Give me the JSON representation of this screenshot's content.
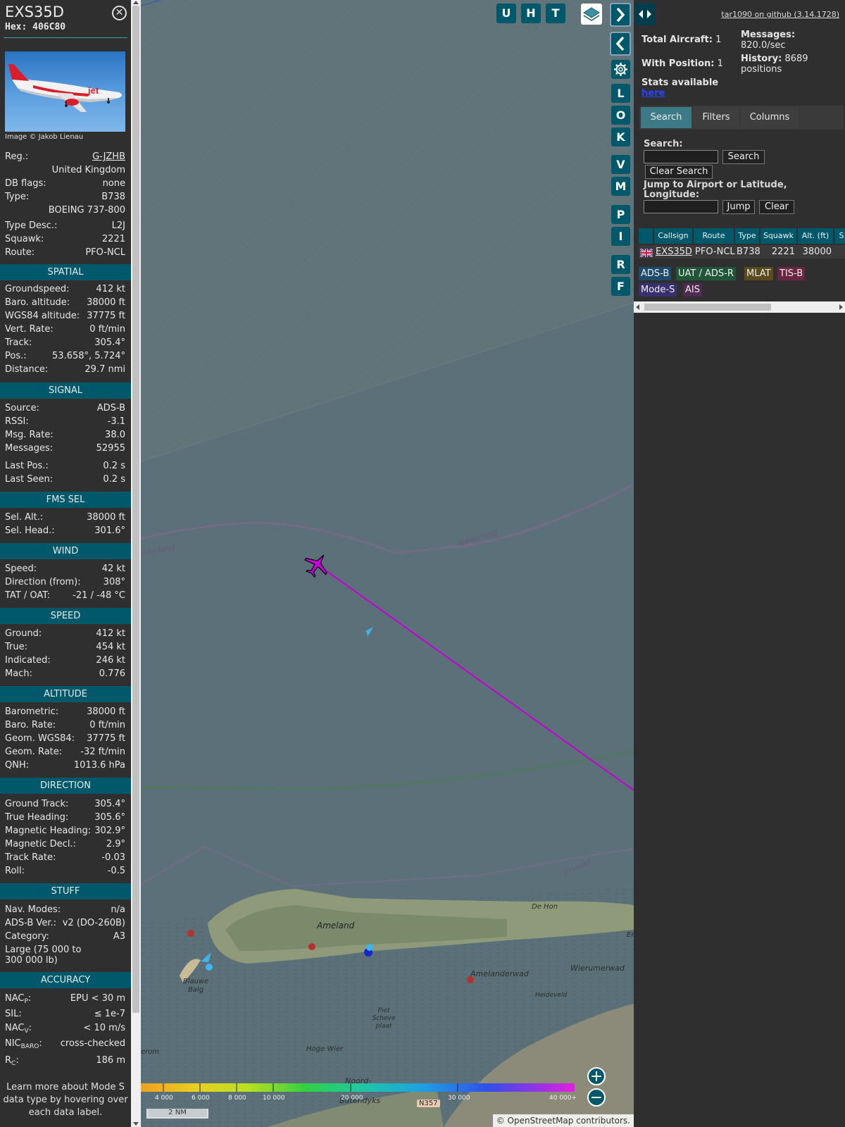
{
  "aircraft": {
    "callsign": "EXS35D",
    "hex_label": "Hex:",
    "hex": "406C80",
    "image_credit": "Image © Jakob Lienau"
  },
  "details": [
    {
      "k": "Reg.:",
      "v": "G-JZHB",
      "link": true
    },
    {
      "k": "",
      "v": "United Kingdom"
    },
    {
      "k": "DB flags:",
      "v": "none"
    },
    {
      "k": "Type:",
      "v": "B738"
    },
    {
      "k": "",
      "v": "BOEING 737-800"
    },
    {
      "k": "Type Desc.:",
      "v": "L2J"
    },
    {
      "k": "Squawk:",
      "v": "2221"
    },
    {
      "k": "Route:",
      "v": "PFO-NCL"
    }
  ],
  "sections": {
    "spatial": {
      "title": "SPATIAL",
      "rows": [
        {
          "k": "Groundspeed:",
          "v": "412 kt"
        },
        {
          "k": "Baro. altitude:",
          "v": "38000 ft"
        },
        {
          "k": "WGS84 altitude:",
          "v": "37775 ft"
        },
        {
          "k": "Vert. Rate:",
          "v": "0 ft/min"
        },
        {
          "k": "Track:",
          "v": "305.4°"
        },
        {
          "k": "Pos.:",
          "v": "53.658°, 5.724°"
        },
        {
          "k": "Distance:",
          "v": "29.7 nmi"
        }
      ]
    },
    "signal": {
      "title": "SIGNAL",
      "rows": [
        {
          "k": "Source:",
          "v": "ADS-B"
        },
        {
          "k": "RSSI:",
          "v": "-3.1"
        },
        {
          "k": "Msg. Rate:",
          "v": "38.0"
        },
        {
          "k": "Messages:",
          "v": "52955"
        },
        {
          "k": "Last Pos.:",
          "v": "0.2 s"
        },
        {
          "k": "Last Seen:",
          "v": "0.2 s"
        }
      ]
    },
    "fms": {
      "title": "FMS SEL",
      "rows": [
        {
          "k": "Sel. Alt.:",
          "v": "38000 ft"
        },
        {
          "k": "Sel. Head.:",
          "v": "301.6°"
        }
      ]
    },
    "wind": {
      "title": "WIND",
      "rows": [
        {
          "k": "Speed:",
          "v": "42 kt"
        },
        {
          "k": "Direction (from):",
          "v": "308°"
        },
        {
          "k": "TAT / OAT:",
          "v": "-21 / -48 °C"
        }
      ]
    },
    "speed": {
      "title": "SPEED",
      "rows": [
        {
          "k": "Ground:",
          "v": "412 kt"
        },
        {
          "k": "True:",
          "v": "454 kt"
        },
        {
          "k": "Indicated:",
          "v": "246 kt"
        },
        {
          "k": "Mach:",
          "v": "0.776"
        }
      ]
    },
    "altitude": {
      "title": "ALTITUDE",
      "rows": [
        {
          "k": "Barometric:",
          "v": "38000 ft"
        },
        {
          "k": "Baro. Rate:",
          "v": "0 ft/min"
        },
        {
          "k": "Geom. WGS84:",
          "v": "37775 ft"
        },
        {
          "k": "Geom. Rate:",
          "v": "-32 ft/min"
        },
        {
          "k": "QNH:",
          "v": "1013.6 hPa"
        }
      ]
    },
    "direction": {
      "title": "DIRECTION",
      "rows": [
        {
          "k": "Ground Track:",
          "v": "305.4°"
        },
        {
          "k": "True Heading:",
          "v": "305.6°"
        },
        {
          "k": "Magnetic Heading:",
          "v": "302.9°"
        },
        {
          "k": "Magnetic Decl.:",
          "v": "2.9°"
        },
        {
          "k": "Track Rate:",
          "v": "-0.03"
        },
        {
          "k": "Roll:",
          "v": "-0.5"
        }
      ]
    },
    "stuff": {
      "title": "STUFF",
      "rows": [
        {
          "k": "Nav. Modes:",
          "v": "n/a"
        },
        {
          "k": "ADS-B Ver.:",
          "v": "v2 (DO-260B)"
        },
        {
          "k": "Category:",
          "v": "A3"
        }
      ],
      "category_desc": "Large (75 000 to 300 000 lb)"
    },
    "accuracy": {
      "title": "ACCURACY",
      "nacp_k": "NAC",
      "nacp_sub": "P",
      "nacp_v": "EPU < 30 m",
      "sil_k": "SIL:",
      "sil_v": "≤ 1e-7",
      "nacv_k": "NAC",
      "nacv_sub": "V",
      "nacv_v": "< 10 m/s",
      "nic_k": "NIC",
      "nic_sub": "BARO",
      "nic_v": "cross-checked",
      "rc_k": "R",
      "rc_sub": "C",
      "rc_v": "186 m"
    }
  },
  "footer_note": "Learn more about Mode S data type by hovering over each data label.",
  "map": {
    "buttons_top": [
      "U",
      "H",
      "T"
    ],
    "buttons_side": [
      "L",
      "O",
      "K",
      "V",
      "M",
      "P",
      "I",
      "R",
      "F"
    ],
    "color_scale_ticks": [
      "4 000",
      "6 000",
      "8 000",
      "10 000",
      "20 000",
      "30 000",
      "40 000+"
    ],
    "scale_label": "2 NM",
    "attribution": "© OpenStreetMap contributors.",
    "labels": {
      "ameland": "Ameland",
      "nederland_1": "Nederland",
      "nederland_2": "ederland",
      "fryslan": "Fryslân",
      "de_hon": "De Hon",
      "amelanderwad": "Amelanderwad",
      "wierumerwad": "Wierumerwad",
      "heideveld": "Heideveld",
      "blauwe_balg": "Blauwe Balg",
      "piet_scheve": "Piet Scheve plaat",
      "hoge_wier": "Hoge Wier",
      "erom": "erom",
      "noord": "Noord-",
      "butendyks": "Butendyks",
      "n357": "N357",
      "er": "Er"
    }
  },
  "side": {
    "github_link": "tar1090 on github (3.14.1728)",
    "total_aircraft_label": "Total Aircraft:",
    "total_aircraft": "1",
    "with_position_label": "With Position:",
    "with_position": "1",
    "stats_label": "Stats available",
    "stats_link": "here",
    "messages_label": "Messages:",
    "messages_value": "820.0/sec",
    "history_label": "History:",
    "history_value": "8689",
    "history_unit": "positions",
    "tabs": [
      "Search",
      "Filters",
      "Columns"
    ],
    "search_label": "Search:",
    "search_button": "Search",
    "clear_search_button": "Clear Search",
    "jump_label": "Jump to Airport or Latitude, Longitude:",
    "jump_button": "Jump",
    "clear_button": "Clear",
    "table": {
      "headers": [
        "Callsign",
        "Route",
        "Type",
        "Squawk",
        "Alt. (ft)",
        "S"
      ],
      "row": {
        "callsign": "EXS35D",
        "route": "PFO-NCL",
        "type": "B738",
        "squawk": "2221",
        "alt": "38000"
      }
    },
    "sources": [
      {
        "label": "ADS-B",
        "color": "#1e4a6b"
      },
      {
        "label": "UAT / ADS-R",
        "color": "#21553a"
      },
      {
        "label": "MLAT",
        "color": "#5a4a1e"
      },
      {
        "label": "TIS-B",
        "color": "#6a2540"
      },
      {
        "label": "Mode-S",
        "color": "#3a2f6e"
      },
      {
        "label": "AIS",
        "color": "#4f2a52"
      }
    ]
  }
}
